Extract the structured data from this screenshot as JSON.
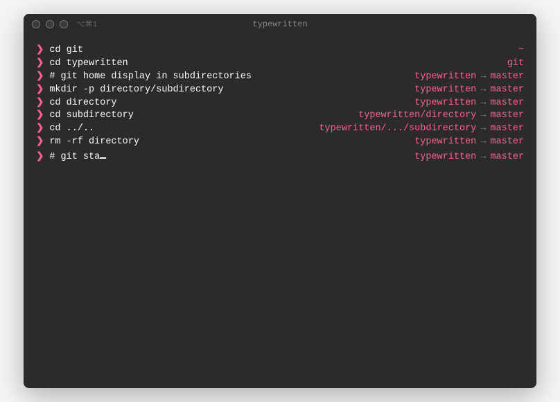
{
  "window": {
    "title": "typewritten",
    "tab_hint": "⌥⌘1"
  },
  "prompt_symbol": "❯",
  "arrow_symbol": "→",
  "lines": [
    {
      "command": "cd git",
      "right_path": "~",
      "right_branch": ""
    },
    {
      "command": "cd typewritten",
      "right_path": "git",
      "right_branch": ""
    },
    {
      "command": "# git home display in subdirectories",
      "right_path": "typewritten",
      "right_branch": "master"
    },
    {
      "command": "mkdir -p directory/subdirectory",
      "right_path": "typewritten",
      "right_branch": "master"
    },
    {
      "command": "cd directory",
      "right_path": "typewritten",
      "right_branch": "master"
    },
    {
      "command": "cd subdirectory",
      "right_path": "typewritten/directory",
      "right_branch": "master"
    },
    {
      "command": "cd ../..",
      "right_path": "typewritten/.../subdirectory",
      "right_branch": "master"
    },
    {
      "command": "rm -rf directory",
      "right_path": "typewritten",
      "right_branch": "master"
    },
    {
      "command": "# git sta",
      "right_path": "typewritten",
      "right_branch": "master",
      "cursor": true
    }
  ]
}
